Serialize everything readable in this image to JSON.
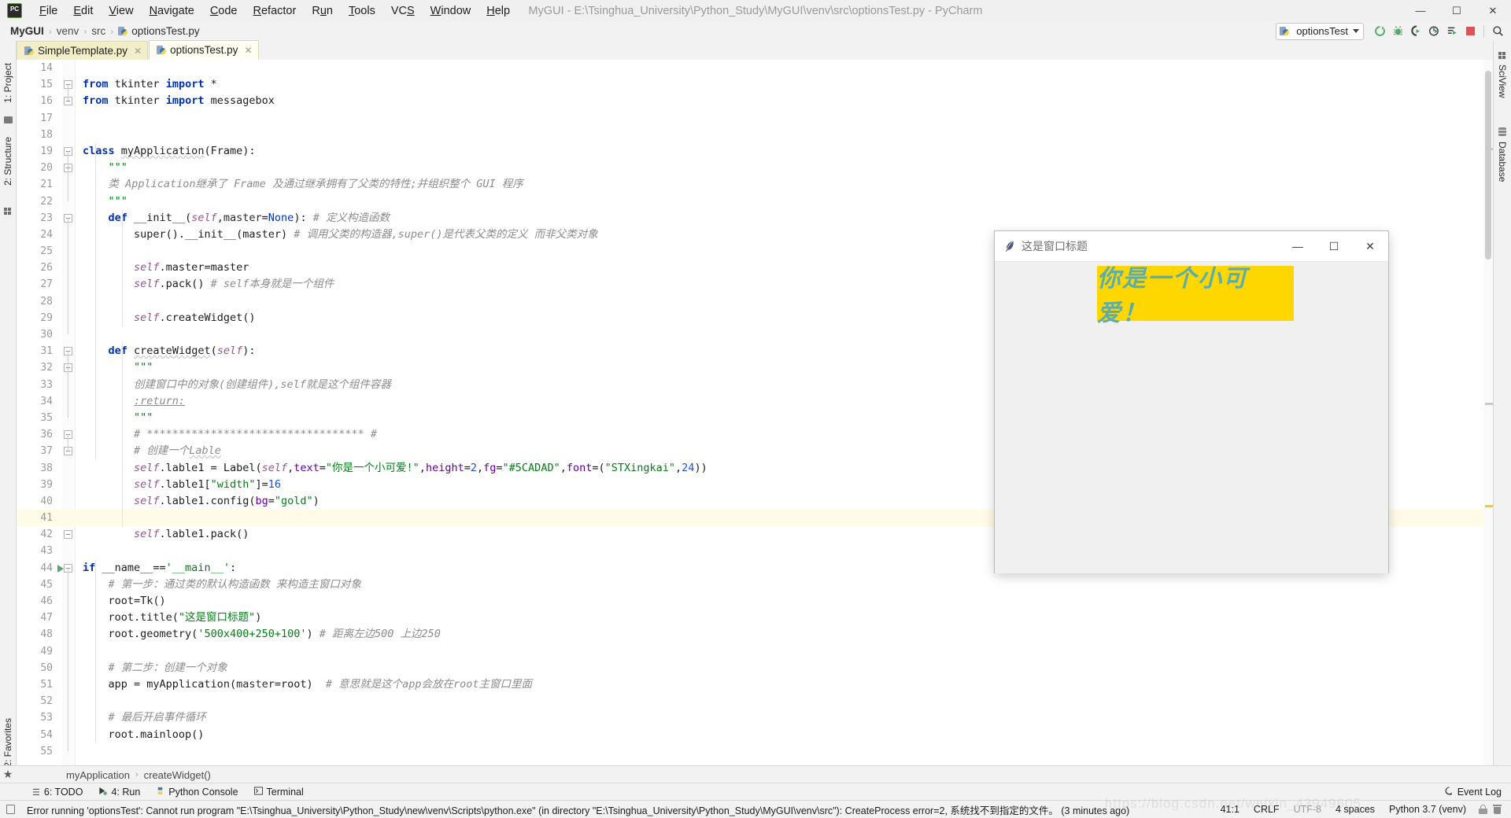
{
  "window": {
    "title": "MyGUI - E:\\Tsinghua_University\\Python_Study\\MyGUI\\venv\\src\\optionsTest.py - PyCharm",
    "minimize_label": "—",
    "maximize_label": "☐",
    "close_label": "✕"
  },
  "menubar": {
    "items": [
      {
        "label": "File"
      },
      {
        "label": "Edit"
      },
      {
        "label": "View"
      },
      {
        "label": "Navigate"
      },
      {
        "label": "Code"
      },
      {
        "label": "Refactor"
      },
      {
        "label": "Run"
      },
      {
        "label": "Tools"
      },
      {
        "label": "VCS"
      },
      {
        "label": "Window"
      },
      {
        "label": "Help"
      }
    ]
  },
  "breadcrumbs": {
    "items": [
      "MyGUI",
      "venv",
      "src",
      "optionsTest.py"
    ],
    "separator": "›"
  },
  "toolbar": {
    "run_config_label": "optionsTest",
    "buttons": [
      {
        "name": "run-button",
        "title": "Run"
      },
      {
        "name": "debug-button",
        "title": "Debug"
      },
      {
        "name": "run-coverage-button",
        "title": "Run with Coverage"
      },
      {
        "name": "profile-button",
        "title": "Profile"
      },
      {
        "name": "run-tests-button",
        "title": "Run Tests"
      },
      {
        "name": "stop-button",
        "title": "Stop"
      },
      {
        "name": "search-button",
        "title": "Search Everywhere"
      }
    ]
  },
  "left_strip": {
    "project_label": "1: Project",
    "structure_label": "2: Structure",
    "favorites_label": "2: Favorites"
  },
  "right_strip": {
    "sciview_label": "SciView",
    "database_label": "Database"
  },
  "editor_tabs": [
    {
      "label": "SimpleTemplate.py",
      "active": false,
      "close": "✕"
    },
    {
      "label": "optionsTest.py",
      "active": true,
      "close": "✕"
    }
  ],
  "editor": {
    "first_line_number": 14,
    "caret_line": 41,
    "lines": [
      {
        "n": 14,
        "tokens": []
      },
      {
        "n": 15,
        "fold": true,
        "tokens": [
          [
            "kw",
            "from"
          ],
          [
            "plain",
            " "
          ],
          [
            "plain",
            "tkinter"
          ],
          [
            "plain",
            " "
          ],
          [
            "kw",
            "import"
          ],
          [
            "plain",
            " *"
          ]
        ]
      },
      {
        "n": 16,
        "fold": true,
        "tokens": [
          [
            "kw",
            "from"
          ],
          [
            "plain",
            " "
          ],
          [
            "plain",
            "tkinter"
          ],
          [
            "plain",
            " "
          ],
          [
            "kw",
            "import"
          ],
          [
            "plain",
            " messagebox"
          ]
        ]
      },
      {
        "n": 17,
        "tokens": []
      },
      {
        "n": 18,
        "tokens": []
      },
      {
        "n": 19,
        "fold": true,
        "tokens": [
          [
            "kw",
            "class"
          ],
          [
            "plain",
            " "
          ],
          [
            "squig",
            "myApplication"
          ],
          [
            "plain",
            "("
          ],
          [
            "plain",
            "Frame"
          ],
          [
            "plain",
            "):"
          ]
        ]
      },
      {
        "n": 20,
        "indent": 1,
        "fold": true,
        "tokens": [
          [
            "str",
            "\"\"\""
          ]
        ]
      },
      {
        "n": 21,
        "indent": 1,
        "tokens": [
          [
            "com",
            "类 Application继承了 Frame 及通过继承拥有了父类的特性;并组织整个 GUI 程序"
          ]
        ]
      },
      {
        "n": 22,
        "indent": 1,
        "tokens": [
          [
            "str",
            "\"\"\""
          ]
        ]
      },
      {
        "n": 23,
        "indent": 1,
        "fold": true,
        "tokens": [
          [
            "kw",
            "def"
          ],
          [
            "plain",
            " "
          ],
          [
            "fn",
            "__init__"
          ],
          [
            "plain",
            "("
          ],
          [
            "self",
            "self"
          ],
          [
            "plain",
            ","
          ],
          [
            "param",
            "master"
          ],
          [
            "plain",
            "="
          ],
          [
            "kw2",
            "None"
          ],
          [
            "plain",
            "): "
          ],
          [
            "com",
            "# 定义构造函数"
          ]
        ]
      },
      {
        "n": 24,
        "indent": 2,
        "tokens": [
          [
            "plain",
            "super()."
          ],
          [
            "fn",
            "__init__"
          ],
          [
            "plain",
            "(master) "
          ],
          [
            "com",
            "# 调用父类的构造器,super()是代表父类的定义 而非父类对象"
          ]
        ]
      },
      {
        "n": 25,
        "indent": 2,
        "tokens": []
      },
      {
        "n": 26,
        "indent": 2,
        "tokens": [
          [
            "self",
            "self"
          ],
          [
            "plain",
            ".master=master"
          ]
        ]
      },
      {
        "n": 27,
        "indent": 2,
        "tokens": [
          [
            "self",
            "self"
          ],
          [
            "plain",
            ".pack() "
          ],
          [
            "com",
            "# self本身就是一个组件"
          ]
        ]
      },
      {
        "n": 28,
        "indent": 2,
        "tokens": []
      },
      {
        "n": 29,
        "indent": 2,
        "tokens": [
          [
            "self",
            "self"
          ],
          [
            "plain",
            ".createWidget()"
          ]
        ]
      },
      {
        "n": 30,
        "indent": 1,
        "tokens": []
      },
      {
        "n": 31,
        "indent": 1,
        "fold": true,
        "tokens": [
          [
            "kw",
            "def"
          ],
          [
            "plain",
            " "
          ],
          [
            "squig",
            "createWidget"
          ],
          [
            "plain",
            "("
          ],
          [
            "self",
            "self"
          ],
          [
            "plain",
            "):"
          ]
        ]
      },
      {
        "n": 32,
        "indent": 2,
        "fold": true,
        "tokens": [
          [
            "str",
            "\"\"\""
          ]
        ]
      },
      {
        "n": 33,
        "indent": 2,
        "tokens": [
          [
            "com",
            "创建窗口中的对象(创建组件),self就是这个组件容器"
          ]
        ]
      },
      {
        "n": 34,
        "indent": 2,
        "tokens": [
          [
            "comul",
            ":return:"
          ]
        ]
      },
      {
        "n": 35,
        "indent": 2,
        "tokens": [
          [
            "str",
            "\"\"\""
          ]
        ]
      },
      {
        "n": 36,
        "indent": 2,
        "fold": true,
        "tokens": [
          [
            "com",
            "# ********************************** #"
          ]
        ]
      },
      {
        "n": 37,
        "indent": 2,
        "fold": true,
        "tokens": [
          [
            "com",
            "# 创建一个"
          ],
          [
            "comsq",
            "Lable"
          ]
        ]
      },
      {
        "n": 38,
        "indent": 2,
        "tokens": [
          [
            "self",
            "self"
          ],
          [
            "plain",
            ".lable1 = Label("
          ],
          [
            "self",
            "self"
          ],
          [
            "plain",
            ","
          ],
          [
            "kwarg",
            "text"
          ],
          [
            "plain",
            "="
          ],
          [
            "str",
            "\"你是一个小可爱!\""
          ],
          [
            "plain",
            ","
          ],
          [
            "kwarg",
            "height"
          ],
          [
            "plain",
            "="
          ],
          [
            "num2",
            "2"
          ],
          [
            "plain",
            ","
          ],
          [
            "kwarg",
            "fg"
          ],
          [
            "plain",
            "="
          ],
          [
            "str",
            "\"#5CADAD\""
          ],
          [
            "plain",
            ","
          ],
          [
            "kwarg",
            "font"
          ],
          [
            "plain",
            "=("
          ],
          [
            "str",
            "\"STXingkai\""
          ],
          [
            "plain",
            ","
          ],
          [
            "num2",
            "24"
          ],
          [
            "plain",
            "))"
          ]
        ]
      },
      {
        "n": 39,
        "indent": 2,
        "tokens": [
          [
            "self",
            "self"
          ],
          [
            "plain",
            ".lable1["
          ],
          [
            "str",
            "\"width\""
          ],
          [
            "plain",
            "]="
          ],
          [
            "num2",
            "16"
          ]
        ]
      },
      {
        "n": 40,
        "indent": 2,
        "tokens": [
          [
            "self",
            "self"
          ],
          [
            "plain",
            ".lable1.config("
          ],
          [
            "kwarg",
            "bg"
          ],
          [
            "plain",
            "="
          ],
          [
            "str",
            "\"gold\""
          ],
          [
            "plain",
            ")"
          ]
        ]
      },
      {
        "n": 41,
        "indent": 2,
        "tokens": [],
        "highlight": true
      },
      {
        "n": 42,
        "indent": 2,
        "fold": true,
        "tokens": [
          [
            "self",
            "self"
          ],
          [
            "plain",
            ".lable1.pack()"
          ]
        ]
      },
      {
        "n": 43,
        "tokens": []
      },
      {
        "n": 44,
        "fold": true,
        "runmark": true,
        "tokens": [
          [
            "kw",
            "if"
          ],
          [
            "plain",
            " __name__=="
          ],
          [
            "str",
            "'__main__'"
          ],
          [
            "plain",
            ":"
          ]
        ]
      },
      {
        "n": 45,
        "indent": 1,
        "tokens": [
          [
            "com",
            "# 第一步：通过类的默认构造函数 来构造主窗口对象"
          ]
        ]
      },
      {
        "n": 46,
        "indent": 1,
        "tokens": [
          [
            "plain",
            "root=Tk()"
          ]
        ]
      },
      {
        "n": 47,
        "indent": 1,
        "tokens": [
          [
            "plain",
            "root.title("
          ],
          [
            "str",
            "\"这是窗口标题\""
          ],
          [
            "plain",
            ")"
          ]
        ]
      },
      {
        "n": 48,
        "indent": 1,
        "tokens": [
          [
            "plain",
            "root.geometry("
          ],
          [
            "str",
            "'500x400+250+100'"
          ],
          [
            "plain",
            ") "
          ],
          [
            "com",
            "# 距离左边500 上边250"
          ]
        ]
      },
      {
        "n": 49,
        "indent": 1,
        "tokens": []
      },
      {
        "n": 50,
        "indent": 1,
        "tokens": [
          [
            "com",
            "# 第二步：创建一个对象"
          ]
        ]
      },
      {
        "n": 51,
        "indent": 1,
        "tokens": [
          [
            "plain",
            "app = myApplication("
          ],
          [
            "param",
            "master"
          ],
          [
            "plain",
            "=root)  "
          ],
          [
            "com",
            "# 意思就是这个app会放在root主窗口里面"
          ]
        ]
      },
      {
        "n": 52,
        "indent": 1,
        "tokens": []
      },
      {
        "n": 53,
        "indent": 1,
        "tokens": [
          [
            "com",
            "# 最后开启事件循环"
          ]
        ]
      },
      {
        "n": 54,
        "indent": 1,
        "tokens": [
          [
            "plain",
            "root.mainloop()"
          ]
        ]
      },
      {
        "n": 55,
        "tokens": []
      }
    ]
  },
  "tk_window": {
    "title": "这是窗口标题",
    "label_text": "你是一个小可爱！",
    "label_bg": "#ffd700",
    "label_fg": "#5CADAD",
    "minimize_label": "—",
    "maximize_label": "☐",
    "close_label": "✕"
  },
  "bottom_breadcrumb": {
    "items": [
      "myApplication",
      "createWidget()"
    ],
    "separator": "›"
  },
  "tool_windows": [
    {
      "label": "6: TODO",
      "icon": "todo-icon"
    },
    {
      "label": "4: Run",
      "icon": "run-icon"
    },
    {
      "label": "Python Console",
      "icon": "python-console-icon"
    },
    {
      "label": "Terminal",
      "icon": "terminal-icon"
    }
  ],
  "event_log": {
    "label": "Event Log"
  },
  "statusbar": {
    "message": "Error running 'optionsTest': Cannot run program \"E:\\Tsinghua_University\\Python_Study\\new\\venv\\Scripts\\python.exe\" (in directory \"E:\\Tsinghua_University\\Python_Study\\MyGUI\\venv\\src\"): CreateProcess error=2, 系统找不到指定的文件。  (3 minutes ago)",
    "caret_position": "41:1",
    "line_separator": "CRLF",
    "encoding": "UTF-8",
    "indent": "4 spaces",
    "interpreter": "Python 3.7 (venv)"
  },
  "colors": {
    "accent_green": "#59a869",
    "stop_red": "#e05252",
    "tab_bg": "#f2eec8",
    "tab_active_bg": "#fffef2",
    "gold": "#ffd700",
    "teal": "#5CADAD"
  }
}
